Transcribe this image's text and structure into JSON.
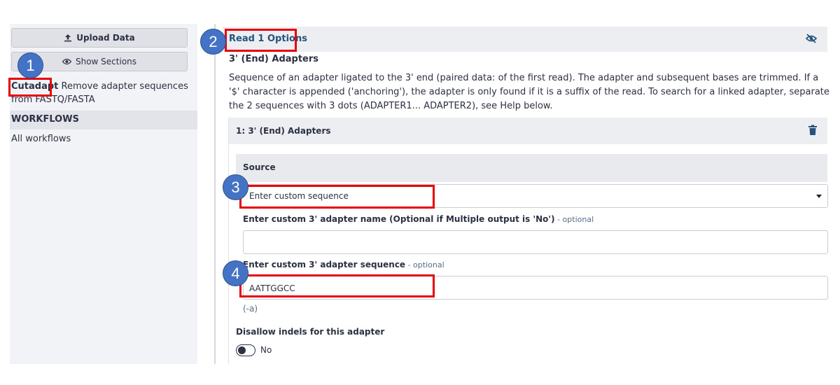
{
  "left_panel": {
    "upload_label": "Upload Data",
    "show_sections_label": "Show Sections",
    "tool": {
      "name": "Cutadapt",
      "description": " Remove adapter sequences from FASTQ/FASTA"
    },
    "workflows_heading": "WORKFLOWS",
    "all_workflows_label": "All workflows"
  },
  "form": {
    "section_title": "Read 1 Options",
    "adapters_label": "3' (End) Adapters",
    "adapters_help": "Sequence of an adapter ligated to the 3' end (paired data: of the first read). The adapter and subsequent bases are trimmed. If a '$' character is appended ('anchoring'), the adapter is only found if it is a suffix of the read. To search for a linked adapter, separate the 2 sequences with 3 dots (ADAPTER1... ADAPTER2), see Help below.",
    "repeat_title": "1: 3' (End) Adapters",
    "source_label": "Source",
    "source_value": "Enter custom sequence",
    "name_label": "Enter custom 3' adapter name (Optional if Multiple output is 'No')",
    "name_optional": " - optional",
    "name_value": "",
    "sequence_label": "Enter custom 3' adapter sequence",
    "sequence_optional": " - optional",
    "sequence_value": "AATTGGCC",
    "sequence_argument": "(-a)",
    "indels_label": "Disallow indels for this adapter",
    "indels_value": "No"
  },
  "annotations": {
    "badge_1": "1",
    "badge_2": "2",
    "badge_3": "3",
    "badge_4": "4",
    "highlight_color": "#e5000b",
    "badge_color": "#4472c4"
  },
  "icons": {
    "upload": "upload-icon",
    "show_sections": "eye-icon",
    "collapse": "eye-slash-icon",
    "delete": "trash-icon",
    "dropdown": "caret-down-icon"
  }
}
